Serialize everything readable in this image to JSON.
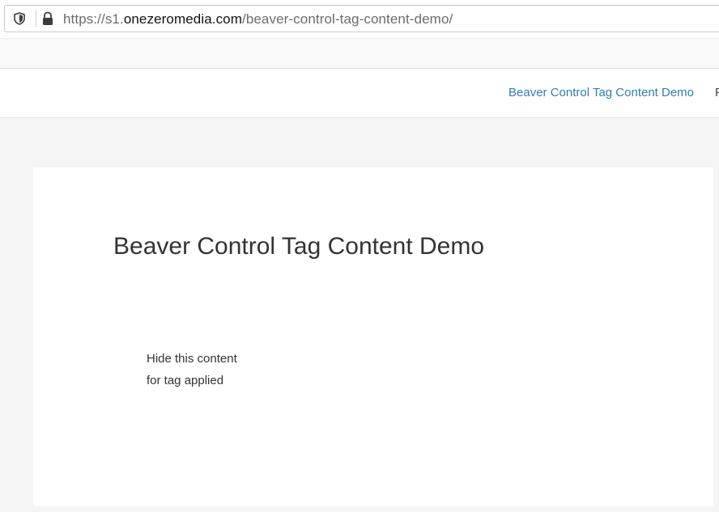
{
  "browser": {
    "url_prefix": "https://s1.",
    "url_host": "onezeromedia.com",
    "url_path": "/beaver-control-tag-content-demo/"
  },
  "header": {
    "nav": [
      {
        "label": "Beaver Control Tag Content Demo"
      },
      {
        "label": "F"
      }
    ]
  },
  "content": {
    "title": "Beaver Control Tag Content Demo",
    "lines": [
      "Hide this content",
      "for tag applied"
    ]
  },
  "colors": {
    "link": "#2f7fb4",
    "page_bg": "#f5f5f5",
    "text": "#333333"
  },
  "icons": [
    "shield-icon",
    "lock-icon"
  ]
}
